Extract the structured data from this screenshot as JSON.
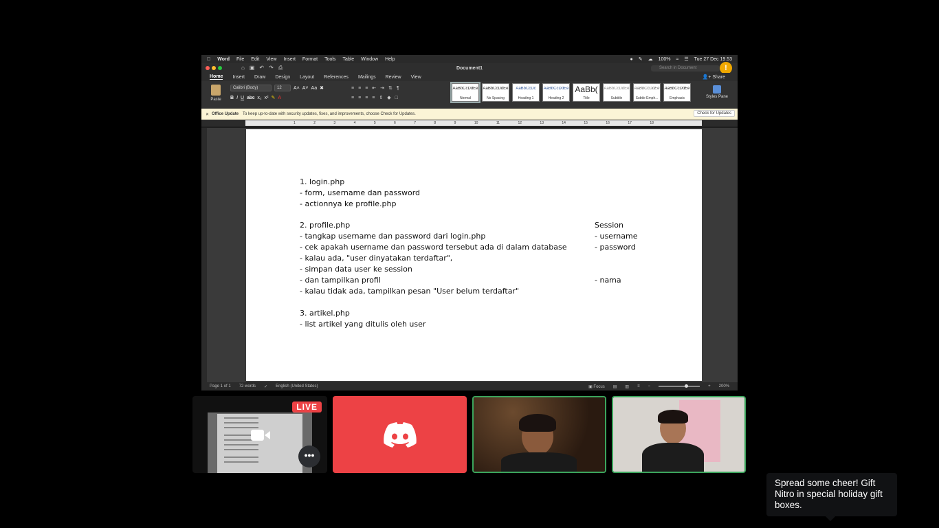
{
  "mac_menubar": {
    "app_name": "Word",
    "menus": [
      "File",
      "Edit",
      "View",
      "Insert",
      "Format",
      "Tools",
      "Table",
      "Window",
      "Help"
    ],
    "battery": "100%",
    "clock": "Tue 27 Dec 19.53"
  },
  "word": {
    "doc_title": "Document1",
    "search_placeholder": "Search in Document",
    "ribbon_tabs": [
      "Home",
      "Insert",
      "Draw",
      "Design",
      "Layout",
      "References",
      "Mailings",
      "Review",
      "View"
    ],
    "active_tab": "Home",
    "share_label": "Share",
    "paste_label": "Paste",
    "font_name": "Calibri (Body)",
    "font_size": "12",
    "styles": [
      {
        "sample": "AaBbCcDdEe",
        "name": "Normal"
      },
      {
        "sample": "AaBbCcDdEe",
        "name": "No Spacing"
      },
      {
        "sample": "AaBbCcDc",
        "name": "Heading 1"
      },
      {
        "sample": "AaBbCcDdEe",
        "name": "Heading 2"
      },
      {
        "sample": "AaBb(",
        "name": "Title"
      },
      {
        "sample": "AaBbCcDdEe",
        "name": "Subtitle"
      },
      {
        "sample": "AaBbCcDdEe",
        "name": "Subtle Emph..."
      },
      {
        "sample": "AaBbCcDdEe",
        "name": "Emphasis"
      }
    ],
    "styles_pane_label": "Styles Pane",
    "update_bar": {
      "title": "Office Update",
      "message": "To keep up-to-date with security updates, fixes, and improvements, choose Check for Updates.",
      "button": "Check for Updates"
    },
    "ruler_ticks": [
      "1",
      "2",
      "3",
      "4",
      "5",
      "6",
      "7",
      "8",
      "9",
      "10",
      "11",
      "12",
      "13",
      "14",
      "15",
      "16",
      "17",
      "18"
    ],
    "document_lines": [
      "1. login.php",
      "- form, username dan password",
      "- actionnya ke profile.php",
      "",
      "2. profile.php",
      "- tangkap username dan password dari login.php",
      "- cek apakah username dan password tersebut ada di dalam database",
      "- kalau ada, \"user dinyatakan terdaftar\",",
      "- simpan data user ke session",
      "- dan tampilkan profil",
      "- kalau tidak ada, tampilkan pesan \"User belum terdaftar\"",
      "",
      "3. artikel.php",
      "- list artikel yang ditulis oleh user"
    ],
    "session_notes": {
      "title": "Session",
      "username": "- username",
      "password": "- password",
      "nama": "- nama"
    },
    "status": {
      "page": "Page 1 of 1",
      "words": "72 words",
      "language": "English (United States)",
      "focus": "Focus",
      "zoom": "200%"
    }
  },
  "call": {
    "live_badge": "LIVE",
    "more_label": "•••"
  },
  "tooltip": {
    "text": "Spread some cheer! Gift Nitro in special holiday gift boxes."
  },
  "colors": {
    "discord_red": "#ed4245",
    "speaking_green": "#3ba55c",
    "warning_orange": "#f0a800"
  }
}
